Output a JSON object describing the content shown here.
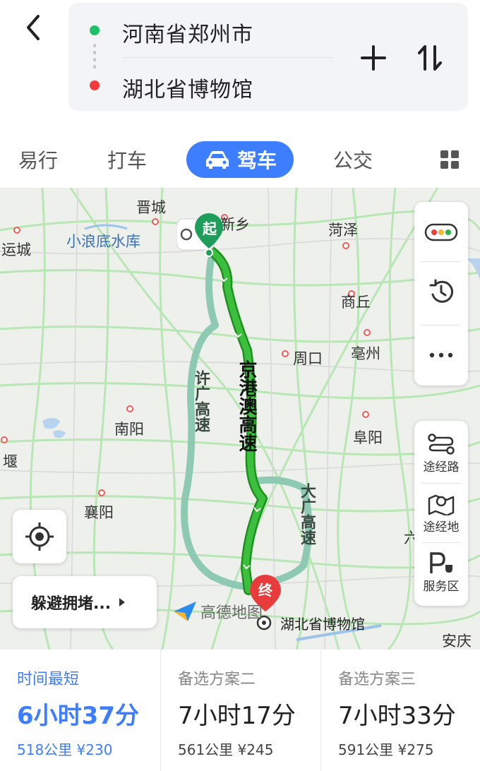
{
  "route": {
    "from": "河南省郑州市",
    "to": "湖北省博物馆"
  },
  "tabs": [
    {
      "label": "易行"
    },
    {
      "label": "打车"
    },
    {
      "label": "驾车"
    },
    {
      "label": "公交"
    }
  ],
  "map": {
    "cities": [
      "晋城",
      "新乡",
      "菏泽",
      "小浪底水库",
      "运城",
      "商丘",
      "周口",
      "亳州",
      "南阳",
      "阜阳",
      "堰",
      "襄阳",
      "六",
      "安庆"
    ],
    "start_marker": "起",
    "end_marker": "终",
    "main_road": "京港澳高速",
    "alt_road_1": "许广高速",
    "alt_road_2": "大广高速",
    "destination_label": "湖北省博物馆",
    "watermark": "高德地图"
  },
  "side_tools": [
    {
      "label": "途经路"
    },
    {
      "label": "途经地"
    },
    {
      "label": "服务区"
    }
  ],
  "avoid_button": "躲避拥堵...",
  "plans": [
    {
      "name": "时间最短",
      "time": "6小时37分",
      "meta": "518公里 ¥230"
    },
    {
      "name": "备选方案二",
      "time": "7小时17分",
      "meta": "561公里 ¥245"
    },
    {
      "name": "备选方案三",
      "time": "7小时33分",
      "meta": "591公里 ¥275"
    }
  ],
  "colors": {
    "accent": "#3d7dff",
    "route_green": "#2fb32f",
    "alt_route": "#8ec9b4",
    "start": "#1ec06a",
    "end": "#f03c3c"
  }
}
